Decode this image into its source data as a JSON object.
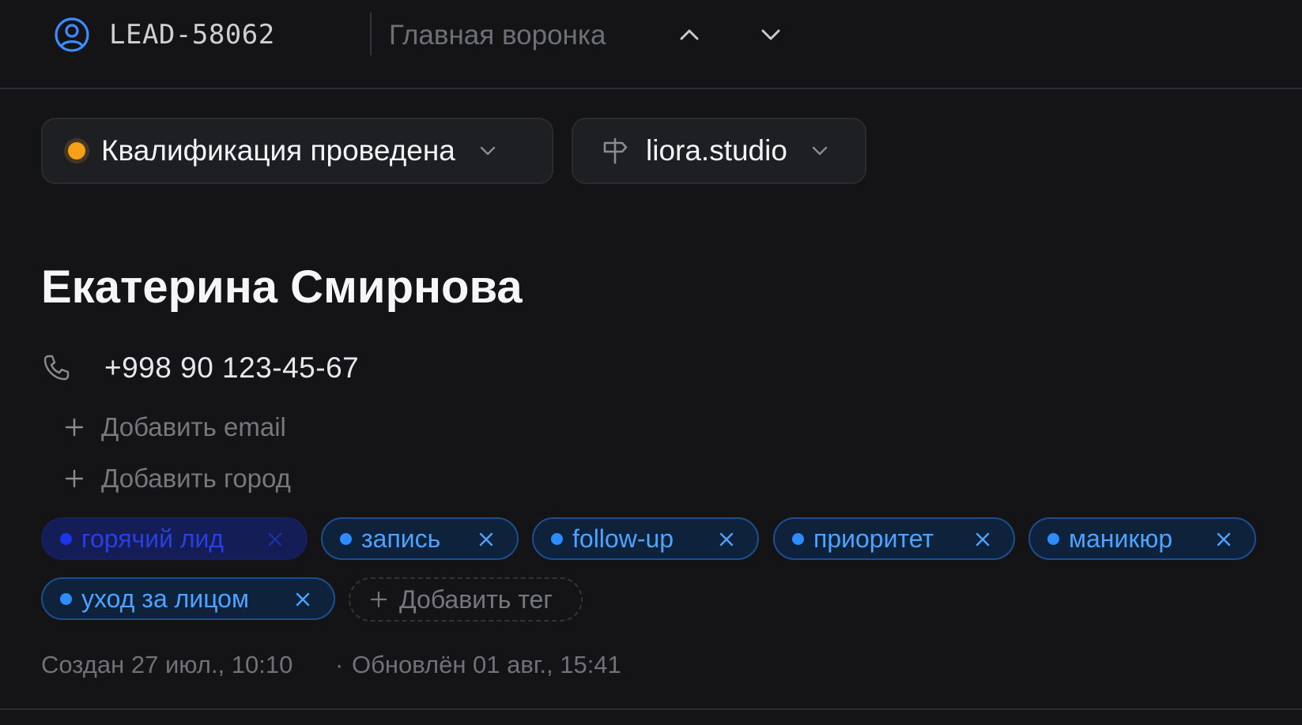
{
  "header": {
    "lead_id": "LEAD-58062",
    "pipeline": "Главная воронка",
    "icons": {
      "lead": "user-circle-icon",
      "prev": "chevron-up-icon",
      "next": "chevron-down-icon"
    }
  },
  "status": {
    "label": "Квалификация проведена",
    "dot_color": "#f5a015"
  },
  "source": {
    "label": "liora.studio",
    "icon": "signpost-icon"
  },
  "contact": {
    "name": "Екатерина Смирнова",
    "phone": "+998 90 123-45-67",
    "add_email": "Добавить email",
    "add_city": "Добавить город"
  },
  "tags": [
    {
      "label": "горячий лид",
      "color": "#2a3fe0"
    },
    {
      "label": "запись",
      "color": "#4da3ff"
    },
    {
      "label": "follow-up",
      "color": "#4da3ff"
    },
    {
      "label": "приоритет",
      "color": "#4da3ff"
    },
    {
      "label": "маникюр",
      "color": "#4da3ff"
    },
    {
      "label": "уход за лицом",
      "color": "#4da3ff"
    }
  ],
  "add_tag": "Добавить тег",
  "meta": {
    "created": "Создан 27 июл., 10:10",
    "separator": "·",
    "updated": "Обновлён 01 авг., 15:41"
  }
}
